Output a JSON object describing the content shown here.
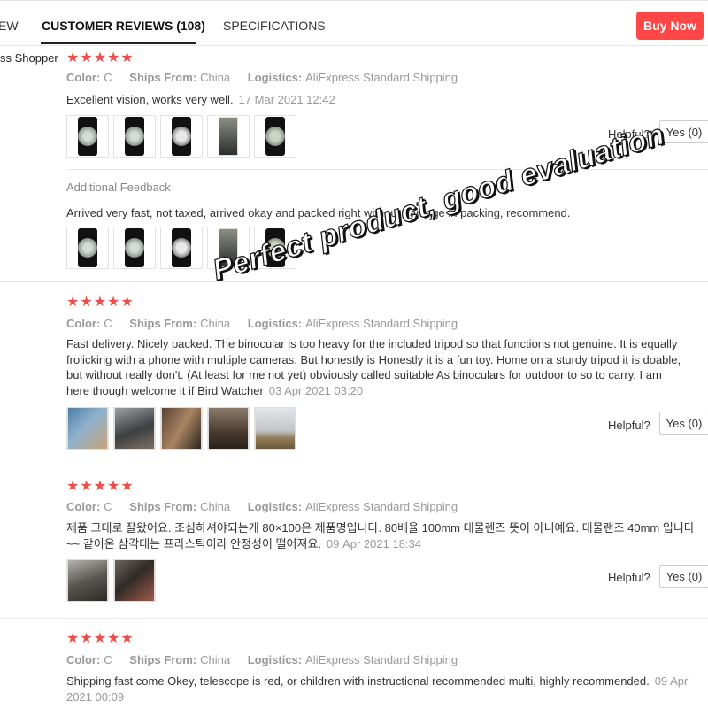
{
  "tabs": {
    "overview_partial": "EW",
    "reviews": "CUSTOMER REVIEWS (108)",
    "specs": "SPECIFICATIONS"
  },
  "buy_now": "Buy Now",
  "first_user": "ss Shopper",
  "stars_text": "★★★★★",
  "meta_labels": {
    "color": "Color:",
    "ships": "Ships From:",
    "logistics": "Logistics:"
  },
  "helpful_label": "Helpful?",
  "yes_label": "Yes (0)",
  "reviews": [
    {
      "color": "C",
      "ships_from": "China",
      "logistics": "AliExpress Standard Shipping",
      "text": "Excellent vision, works very well.",
      "date": "17 Mar 2021 12:42",
      "additional_feedback_title": "Additional Feedback",
      "additional_feedback": "Arrived very fast, not taxed, arrived okay and packed right without damage in packing, recommend."
    },
    {
      "color": "C",
      "ships_from": "China",
      "logistics": "AliExpress Standard Shipping",
      "text": "Fast delivery. Nicely packed. The binocular is too heavy for the included tripod so that functions not genuine. It is equally frolicking with a phone with multiple cameras. But honestly is Honestly it is a fun toy. Home on a sturdy tripod it is doable, but without really don't. (At least for me not yet) obviously called suitable As binoculars for outdoor to so to carry. I am here though welcome it if Bird Watcher",
      "date": "03 Apr 2021 03:20"
    },
    {
      "color": "C",
      "ships_from": "China",
      "logistics": "AliExpress Standard Shipping",
      "text": "제품 그대로 잘왔어요. 조심하셔야되는게 80×100은 제품명입니다. 80배율 100mm 대물렌즈 뜻이 아니예요. 대물랜즈 40mm 입니다~~ 같이온 삼각대는 프라스틱이라 안정성이 떨어져요.",
      "date": "09 Apr 2021 18:34"
    },
    {
      "color": "C",
      "ships_from": "China",
      "logistics": "AliExpress Standard Shipping",
      "text": "Shipping fast come Okey, telescope is red, or children with instructional recommended multi, highly recommended.",
      "date": "09 Apr 2021 00:09"
    }
  ],
  "watermark": "Perfect product, good evaluation"
}
